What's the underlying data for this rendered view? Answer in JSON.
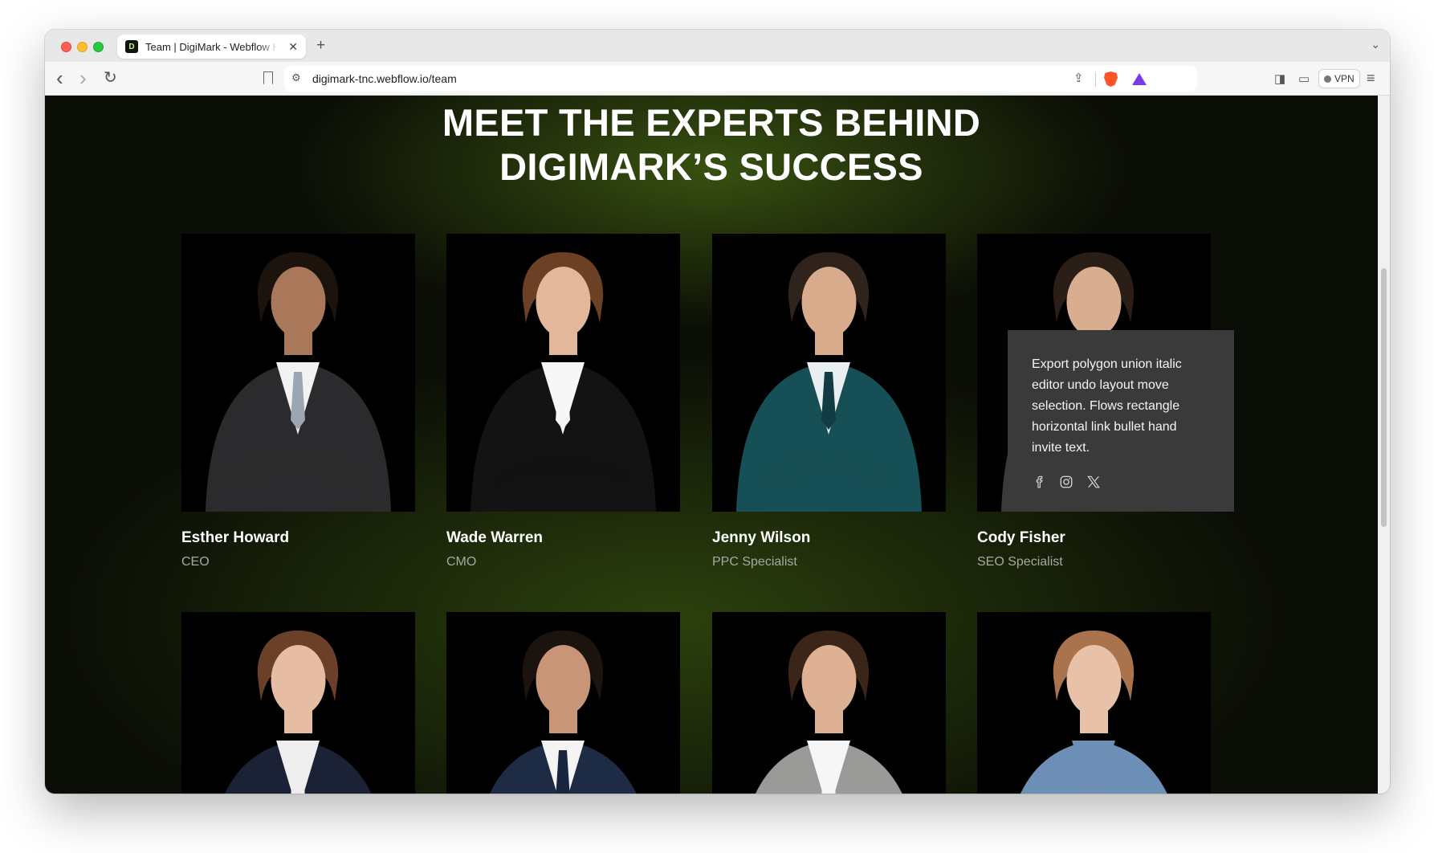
{
  "browser": {
    "tab_title": "Team | DigiMark - Webflow HTML website template",
    "favicon_glyph": "D",
    "url": "digimark-tnc.webflow.io/team",
    "vpn_label": "VPN",
    "new_tab_glyph": "+",
    "close_glyph": "✕",
    "tab_list_glyph": "⌄",
    "back_glyph": "‹",
    "forward_glyph": "›",
    "reload_glyph": "↻",
    "site_info_glyph": "⚙",
    "share_glyph": "⇪",
    "sidebar_glyph": "◨",
    "wallet_glyph": "▭",
    "menu_glyph": "≡"
  },
  "page": {
    "heading_line1": "MEET THE EXPERTS BEHIND",
    "heading_line2": "DIGIMARK’S SUCCESS",
    "team": [
      {
        "name": "Esther Howard",
        "role": "CEO",
        "skin": "#a9785a",
        "hair": "#1c130d",
        "suit": "#2b2b2d",
        "shirt": "#f2f2f2",
        "tie": "#9aa6b2"
      },
      {
        "name": "Wade Warren",
        "role": "CMO",
        "skin": "#e2b79a",
        "hair": "#6b4025",
        "suit": "#131313",
        "shirt": "#f7f7f7",
        "tie": "#f7f7f7"
      },
      {
        "name": "Jenny Wilson",
        "role": "PPC Specialist",
        "skin": "#d8ab8d",
        "hair": "#2f231b",
        "suit": "#164f55",
        "shirt": "#e9eef0",
        "tie": "#123c43"
      },
      {
        "name": "Cody Fisher",
        "role": "SEO Specialist",
        "skin": "#d9ae90",
        "hair": "#2a1e17",
        "suit": "#3a3a3a",
        "shirt": "#3a3a3a",
        "tie": "#3a3a3a"
      },
      {
        "name": "",
        "role": "",
        "skin": "#e6bda3",
        "hair": "#6a4128",
        "suit": "#1b2236",
        "shirt": "#eeeeee",
        "tie": "#eeeeee"
      },
      {
        "name": "",
        "role": "",
        "skin": "#c89676",
        "hair": "#1b130e",
        "suit": "#1e2b45",
        "shirt": "#f4f4f4",
        "tie": "#182640"
      },
      {
        "name": "",
        "role": "",
        "skin": "#deb094",
        "hair": "#3a2518",
        "suit": "#9a9a98",
        "shirt": "#f6f6f6",
        "tie": "#f6f6f6"
      },
      {
        "name": "",
        "role": "",
        "skin": "#e8c2a8",
        "hair": "#a8734d",
        "suit": "#6e8fb5",
        "shirt": "#6e8fb5",
        "tie": "#6e8fb5"
      }
    ],
    "popover": {
      "text": "Export polygon union italic editor undo layout move selection. Flows rectangle horizontal link bullet hand invite text.",
      "social_icons": [
        "facebook-icon",
        "instagram-icon",
        "x-twitter-icon"
      ]
    }
  },
  "colors": {
    "page_background": "#0b0e06",
    "accent_glow": "#405c12",
    "popover_background": "#3a3a3a",
    "role_text": "#a6a99f"
  }
}
